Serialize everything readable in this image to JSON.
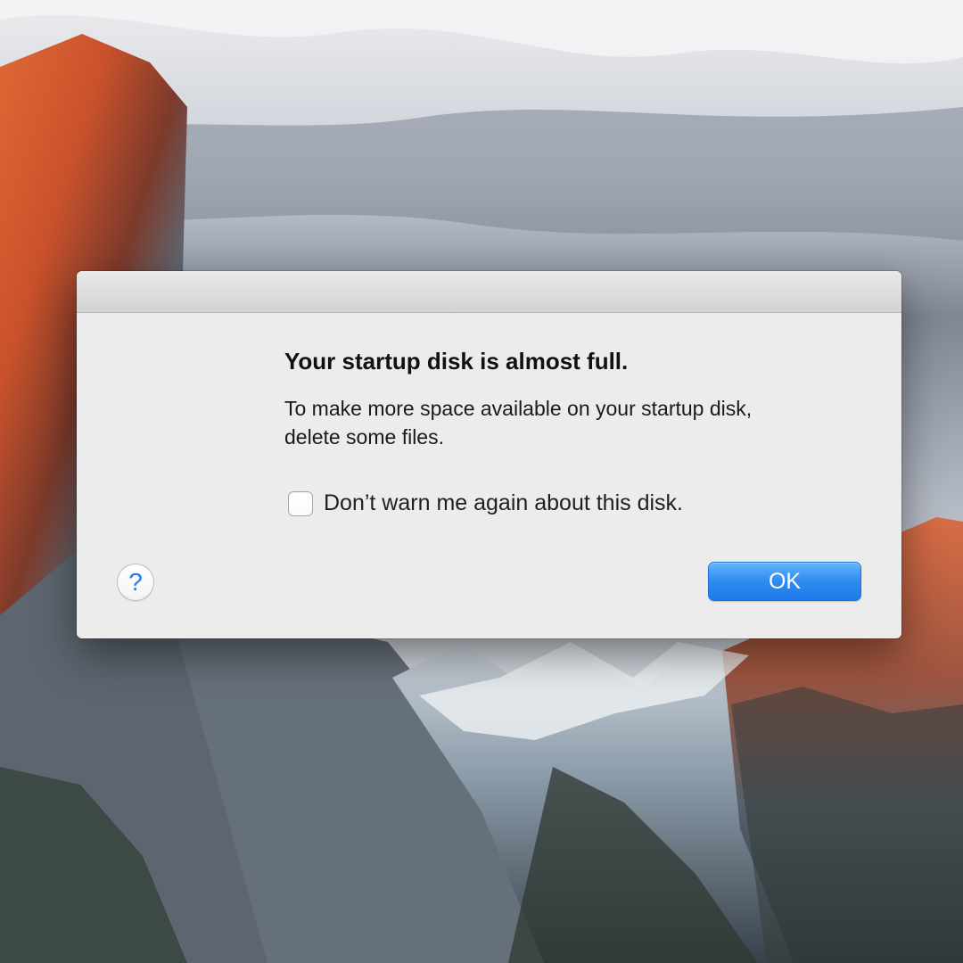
{
  "dialog": {
    "title": "Your startup disk is almost full.",
    "message_line_1": "To make more space available on your startup disk,",
    "message_line_2": "delete some files.",
    "checkbox_label": "Don’t warn me again about this disk.",
    "checkbox_checked": false,
    "help_label": "?",
    "ok_label": "OK"
  },
  "icons": {
    "alert": "warning-icon",
    "help": "help-icon"
  },
  "colors": {
    "ok_button": "#2f8cf0",
    "warning_icon": "#e7bf2a",
    "dialog_background": "#ececec"
  }
}
